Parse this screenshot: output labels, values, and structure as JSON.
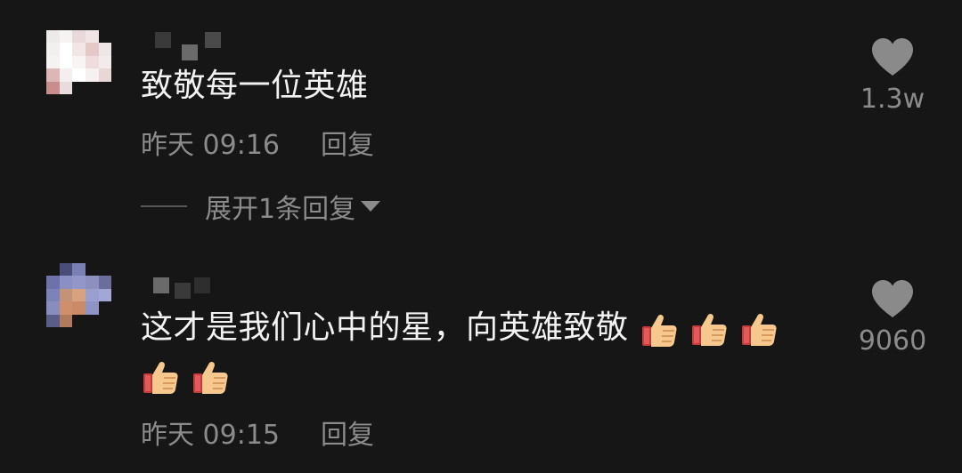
{
  "comments": [
    {
      "text": "致敬每一位英雄",
      "time": "昨天 09:16",
      "reply_label": "回复",
      "like_count": "1.3w",
      "expand_label": "展开1条回复"
    },
    {
      "text": "这才是我们心中的星，向英雄致敬",
      "time": "昨天 09:15",
      "reply_label": "回复",
      "like_count": "9060",
      "emoji_icon": "thumbs-up-icon",
      "emoji_count": 5
    }
  ],
  "colors": {
    "background": "#161616",
    "text": "#f2f2f2",
    "secondary": "#8b8b8b",
    "heart": "#8a8a8a"
  }
}
